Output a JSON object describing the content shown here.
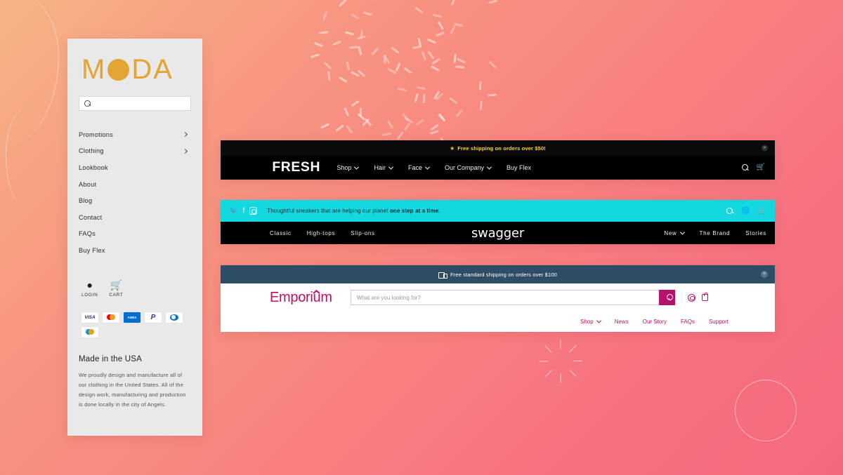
{
  "background": {
    "gradient_from": "#F7B486",
    "gradient_to": "#F4687F",
    "decor": [
      "curve-line",
      "sprinkles",
      "starburst",
      "circle-outline"
    ]
  },
  "moda": {
    "logo": {
      "m": "M",
      "d": "D",
      "a": "A",
      "dot_color": "#E3A431"
    },
    "search": {
      "placeholder": "",
      "value": "",
      "icon": "search-icon"
    },
    "nav": [
      {
        "label": "Promotions",
        "has_chevron": true
      },
      {
        "label": "Clothing",
        "has_chevron": true
      },
      {
        "label": "Lookbook",
        "has_chevron": false
      },
      {
        "label": "About",
        "has_chevron": false
      },
      {
        "label": "Blog",
        "has_chevron": false
      },
      {
        "label": "Contact",
        "has_chevron": false
      },
      {
        "label": "FAQs",
        "has_chevron": false
      },
      {
        "label": "Buy Flex",
        "has_chevron": false
      }
    ],
    "account_icons": [
      {
        "label": "LOGIN",
        "glyph": "●",
        "icon": "user-icon"
      },
      {
        "label": "CART",
        "glyph": "🛒",
        "icon": "cart-icon"
      }
    ],
    "payments": [
      "VISA",
      "Mastercard",
      "AMEX",
      "PayPal",
      "Diners Club",
      "Maestro"
    ],
    "payment_labels": {
      "visa": "VISA",
      "amex": "AMEX",
      "paypal": "P"
    },
    "heading": "Made in the USA",
    "body": "We proudly design and manufacture all of our clothing in the United States. All of the design work, manufacturing and production is done locally in the city of Angels."
  },
  "fresh": {
    "banner": {
      "text": "Free shipping on orders over $50!",
      "star": "★",
      "close": "×",
      "text_color": "#F5D547"
    },
    "logo": "FRESH",
    "nav": [
      {
        "label": "Shop",
        "has_chevron": true
      },
      {
        "label": "Hair",
        "has_chevron": true
      },
      {
        "label": "Face",
        "has_chevron": true
      },
      {
        "label": "Our Company",
        "has_chevron": true
      },
      {
        "label": "Buy Flex",
        "has_chevron": false
      }
    ],
    "icons": [
      {
        "name": "search-icon"
      },
      {
        "name": "basket-icon",
        "glyph": "🛒"
      }
    ],
    "bg_color": "#000000"
  },
  "swagger": {
    "topbar_color": "#14D8E0",
    "social": [
      "twitter-icon",
      "facebook-icon",
      "instagram-icon"
    ],
    "social_glyphs": {
      "twitter": "🐦",
      "facebook": "f"
    },
    "tagline_plain": "Thoughtful sneakers that are helping our planet ",
    "tagline_bold": "one step at a time",
    "tagline_end": ".",
    "top_icons": [
      "search-icon",
      "globe-icon",
      "basket-icon"
    ],
    "globe_glyph": "🌐",
    "basket_glyph": "🛒",
    "logo": "swagger",
    "nav_left": [
      {
        "label": "Classic",
        "has_chevron": false
      },
      {
        "label": "High-tops",
        "has_chevron": false
      },
      {
        "label": "Slip-ons",
        "has_chevron": false
      }
    ],
    "nav_right": [
      {
        "label": "New",
        "has_chevron": true
      },
      {
        "label": "The Brand",
        "has_chevron": false
      },
      {
        "label": "Stories",
        "has_chevron": false
      }
    ]
  },
  "emporium": {
    "banner": {
      "text": "Free standard shipping on orders over $100",
      "icon": "truck-icon",
      "close": "×",
      "bg_color": "#2D4D66"
    },
    "logo": "Emporium",
    "accent_color": "#B5126B",
    "search": {
      "placeholder": "What are you looking for?",
      "value": "",
      "button_icon": "search-icon"
    },
    "icons": [
      {
        "name": "account-icon"
      },
      {
        "name": "bag-icon"
      }
    ],
    "nav": [
      {
        "label": "Shop",
        "has_chevron": true
      },
      {
        "label": "News",
        "has_chevron": false
      },
      {
        "label": "Our Story",
        "has_chevron": false
      },
      {
        "label": "FAQs",
        "has_chevron": false
      },
      {
        "label": "Support",
        "has_chevron": false
      }
    ]
  }
}
